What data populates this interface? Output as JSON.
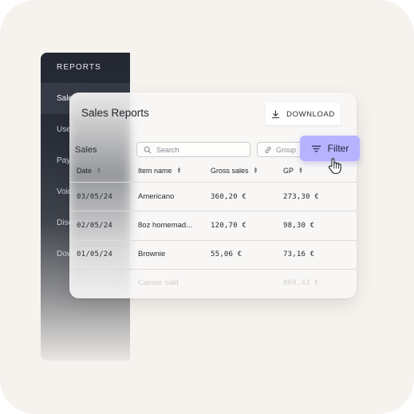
{
  "sidebar": {
    "header": "REPORTS",
    "items": [
      {
        "label": "Sales",
        "active": true
      },
      {
        "label": "Users",
        "active": false
      },
      {
        "label": "Payments",
        "active": false
      },
      {
        "label": "Voids",
        "active": false
      },
      {
        "label": "Discounts",
        "active": false
      },
      {
        "label": "Downloads",
        "active": false
      }
    ]
  },
  "panel": {
    "title": "Sales Reports",
    "download_label": "DOWNLOAD",
    "section_label": "Sales",
    "search_placeholder": "Search",
    "group_placeholder": "Group",
    "filter_label": "Filter"
  },
  "table": {
    "columns": [
      "Date",
      "Item name",
      "Gross sales",
      "GP"
    ],
    "rows": [
      {
        "date": "03/05/24",
        "item": "Americano",
        "gross": "360,20 €",
        "gp": "273,30 €"
      },
      {
        "date": "02/05/24",
        "item": "8oz homemad...",
        "gross": "120,70 €",
        "gp": "98,30 €"
      },
      {
        "date": "01/05/24",
        "item": "Brownie",
        "gross": "55,06 €",
        "gp": "73,16 €"
      },
      {
        "date": "",
        "item": "Caesar sald",
        "gross": "",
        "gp": "869,43 €"
      }
    ]
  },
  "icons": {
    "download": "download-icon",
    "search": "search-icon",
    "group": "link-icon",
    "filter": "filter-lines-icon",
    "cursor": "hand-pointer-icon"
  },
  "colors": {
    "sidebar_bg": "#232731",
    "filter_accent": "#b7b3ff",
    "frame_bg": "#f6f2ee"
  }
}
